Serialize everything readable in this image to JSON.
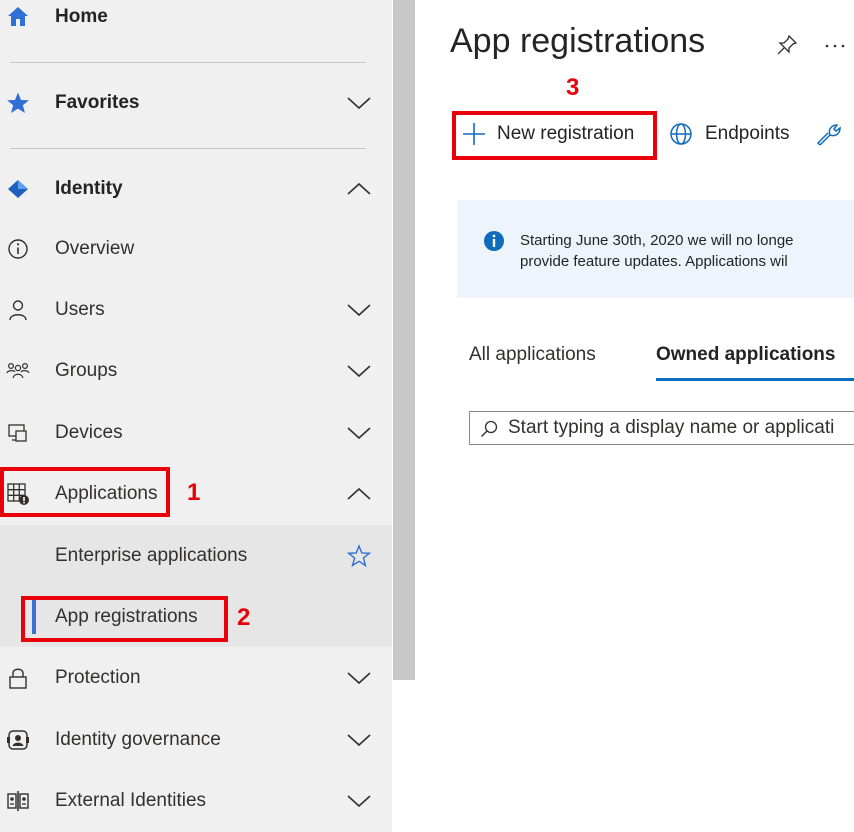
{
  "sidebar": {
    "home": "Home",
    "favorites": "Favorites",
    "identity": "Identity",
    "overview": "Overview",
    "users": "Users",
    "groups": "Groups",
    "devices": "Devices",
    "applications": "Applications",
    "enterprise_applications": "Enterprise applications",
    "app_registrations": "App registrations",
    "protection": "Protection",
    "identity_governance": "Identity governance",
    "external_identities": "External Identities"
  },
  "main": {
    "title": "App registrations",
    "toolbar": {
      "new_registration": "New registration",
      "endpoints": "Endpoints"
    },
    "banner": {
      "line1": "Starting June 30th, 2020 we will no longe",
      "line2": "provide feature updates. Applications wil"
    },
    "tabs": {
      "all": "All applications",
      "owned": "Owned applications"
    },
    "search_placeholder": "Start typing a display name or applicati"
  },
  "annotations": {
    "step1": "1",
    "step2": "2",
    "step3": "3"
  },
  "colors": {
    "accent": "#0f6cbd",
    "annotation_red": "#e8000b",
    "selected_bar": "#3b6fd4",
    "sidebar_bg": "#f0f0f0"
  },
  "icons": {
    "home": "home-icon",
    "favorites": "star-icon",
    "identity": "diamond-icon",
    "overview": "info-icon",
    "users": "person-icon",
    "groups": "group-icon",
    "devices": "devices-icon",
    "applications": "applications-grid-icon",
    "protection": "lock-icon",
    "identity_governance": "governance-icon",
    "external_identities": "external-identities-icon",
    "pin": "pin-icon",
    "more": "more-icon",
    "add": "plus-icon",
    "endpoints": "globe-icon",
    "troubleshoot": "wrench-icon",
    "search": "search-icon",
    "info": "info-filled-icon"
  }
}
